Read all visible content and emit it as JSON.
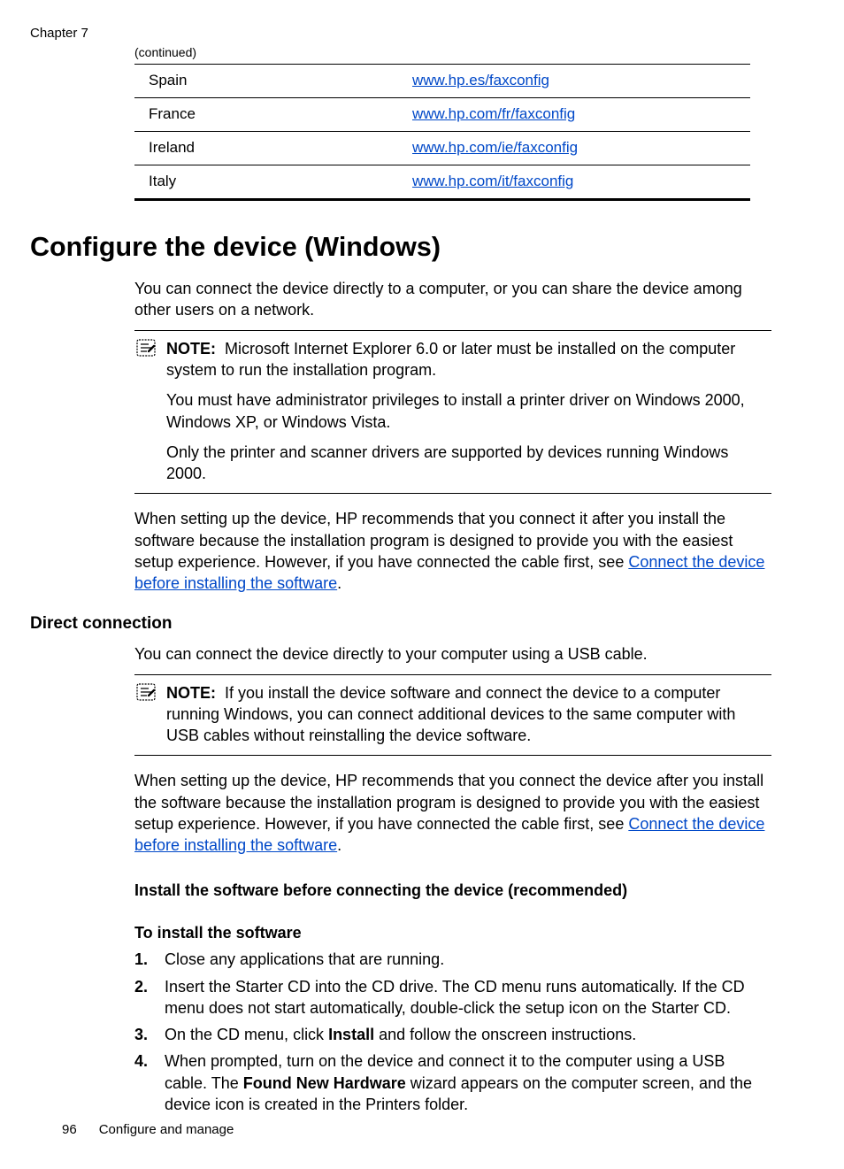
{
  "chapter": "Chapter 7",
  "continued": "(continued)",
  "table_rows": [
    {
      "country": "Spain",
      "url": "www.hp.es/faxconfig"
    },
    {
      "country": "France",
      "url": "www.hp.com/fr/faxconfig"
    },
    {
      "country": "Ireland",
      "url": "www.hp.com/ie/faxconfig"
    },
    {
      "country": "Italy",
      "url": "www.hp.com/it/faxconfig"
    }
  ],
  "h1": "Configure the device (Windows)",
  "intro": "You can connect the device directly to a computer, or you can share the device among other users on a network.",
  "note_label": "NOTE:",
  "note1_paras": [
    "Microsoft Internet Explorer 6.0 or later must be installed on the computer system to run the installation program.",
    "You must have administrator privileges to install a printer driver on Windows 2000, Windows XP, or Windows Vista.",
    "Only the printer and scanner drivers are supported by devices running Windows 2000."
  ],
  "after_note1": {
    "pre": "When setting up the device, HP recommends that you connect it after you install the software because the installation program is designed to provide you with the easiest setup experience. However, if you have connected the cable first, see ",
    "link": "Connect the device before installing the software",
    "post": "."
  },
  "h2": "Direct connection",
  "direct_intro": "You can connect the device directly to your computer using a USB cable.",
  "note2_para": "If you install the device software and connect the device to a computer running Windows, you can connect additional devices to the same computer with USB cables without reinstalling the device software.",
  "after_note2": {
    "pre": "When setting up the device, HP recommends that you connect the device after you install the software because the installation program is designed to provide you with the easiest setup experience. However, if you have connected the cable first, see ",
    "link": "Connect the device before installing the software",
    "post": "."
  },
  "h3": "Install the software before connecting the device (recommended)",
  "h4": "To install the software",
  "steps": [
    "Close any applications that are running.",
    "Insert the Starter CD into the CD drive. The CD menu runs automatically. If the CD menu does not start automatically, double-click the setup icon on the Starter CD.",
    {
      "pre": "On the CD menu, click ",
      "bold": "Install",
      "post": " and follow the onscreen instructions."
    },
    {
      "pre": "When prompted, turn on the device and connect it to the computer using a USB cable. The ",
      "bold": "Found New Hardware",
      "post": " wizard appears on the computer screen, and the device icon is created in the Printers folder."
    }
  ],
  "footer_page": "96",
  "footer_title": "Configure and manage"
}
